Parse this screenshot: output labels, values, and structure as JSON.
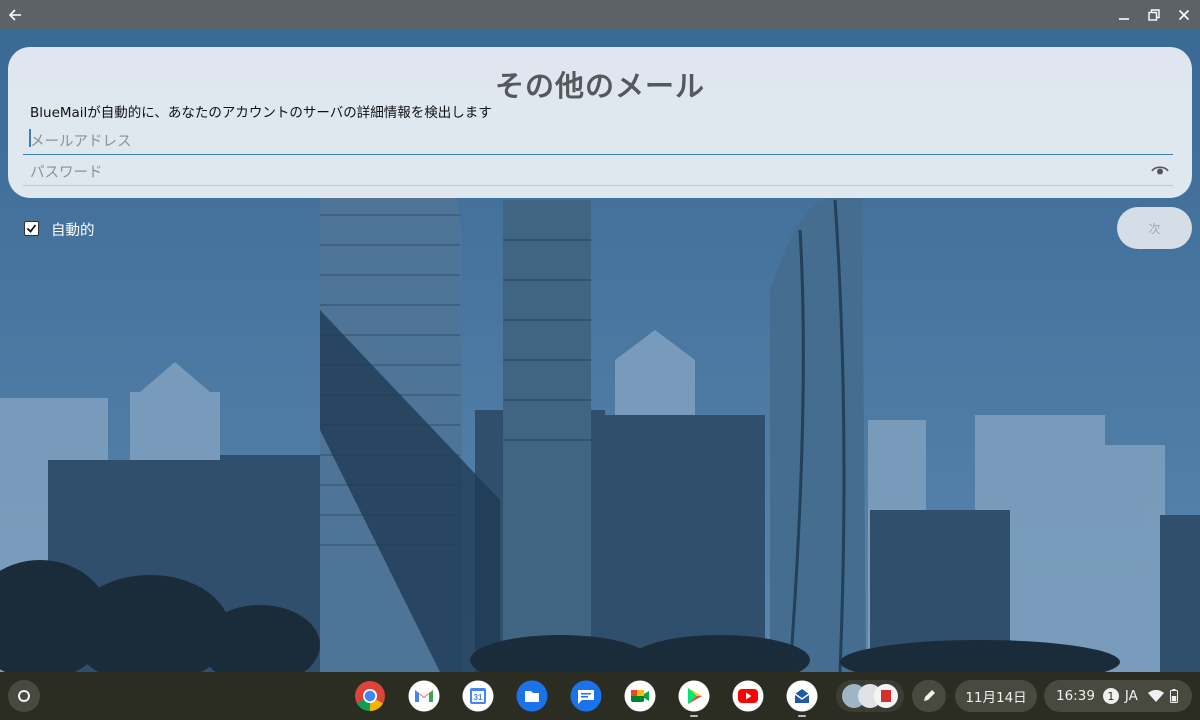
{
  "window": {
    "back_icon": "back-arrow-icon",
    "controls": [
      "minimize-icon",
      "restore-icon",
      "close-icon"
    ]
  },
  "form": {
    "title": "その他のメール",
    "subtitle": "BlueMailが自動的に、あなたのアカウントのサーバの詳細情報を検出します",
    "email_placeholder": "メールアドレス",
    "password_placeholder": "パスワード",
    "password_toggle_icon": "eye-icon",
    "auto_label": "自動的",
    "auto_checked": true,
    "next_label": "次"
  },
  "shelf": {
    "apps": [
      {
        "name": "chrome",
        "icon": "chrome-icon"
      },
      {
        "name": "gmail",
        "icon": "gmail-icon"
      },
      {
        "name": "calendar",
        "icon": "calendar-icon",
        "text": "31"
      },
      {
        "name": "files",
        "icon": "files-icon"
      },
      {
        "name": "messages",
        "icon": "messages-icon"
      },
      {
        "name": "meet",
        "icon": "meet-icon"
      },
      {
        "name": "play-store",
        "icon": "play-store-icon"
      },
      {
        "name": "youtube",
        "icon": "youtube-icon"
      },
      {
        "name": "bluemail",
        "icon": "bluemail-icon"
      }
    ],
    "pen_icon": "stylus-icon",
    "date": "11月14日",
    "time": "16:39",
    "notification_count": "1",
    "ime": "JA",
    "status_icons": [
      "wifi-icon",
      "battery-icon"
    ]
  },
  "colors": {
    "accent": "#3a7fae",
    "shelf": "#2c2d22",
    "titlebar": "#5d6267"
  }
}
